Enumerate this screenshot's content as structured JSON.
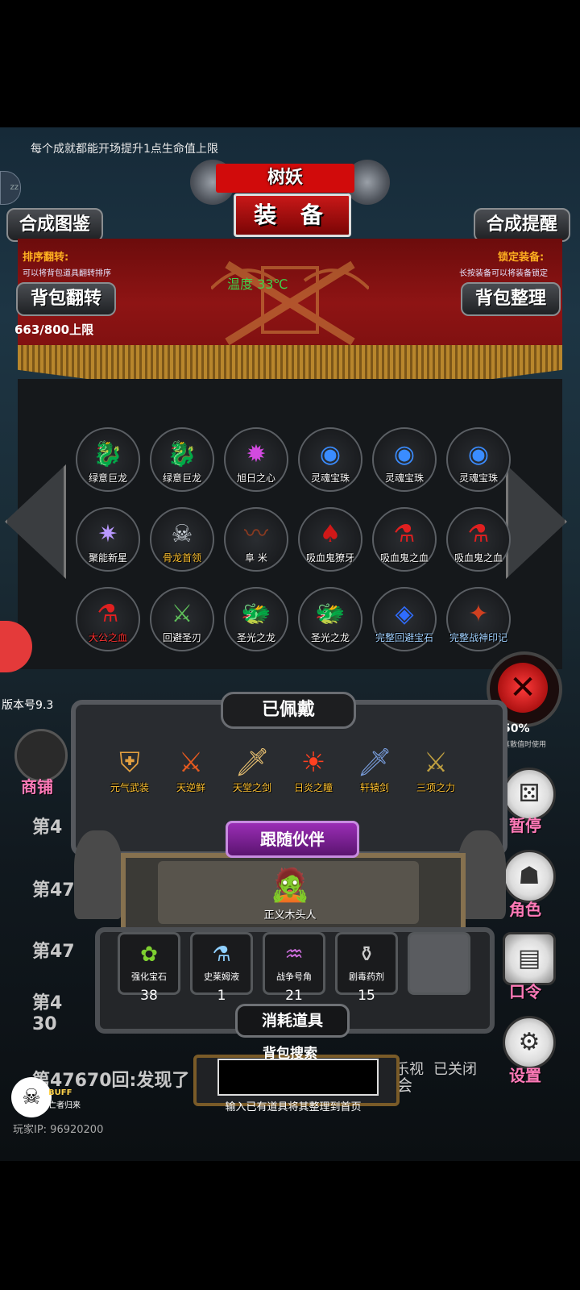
{
  "top_tip": "每个成就都能开场提升1点生命值上限",
  "banner": {
    "name": "树妖",
    "title": "装 备"
  },
  "buttons": {
    "compose_guide": "合成图鉴",
    "compose_remind": "合成提醒",
    "bag_flip": "背包翻转",
    "bag_sort": "背包整理"
  },
  "sort_flip": {
    "head": "排序翻转:",
    "desc": "可以将背包道具翻转排序"
  },
  "lock_equip": {
    "head": "锁定装备:",
    "desc": "长按装备可以将装备锁定"
  },
  "temperature": "温度 33℃",
  "capacity": "663/800上限",
  "inventory": [
    {
      "label": "绿意巨龙",
      "icon": "green-dragon",
      "color": "#ffffff"
    },
    {
      "label": "绿意巨龙",
      "icon": "green-dragon",
      "color": "#ffffff"
    },
    {
      "label": "旭日之心",
      "icon": "rising-sun-heart",
      "color": "#ffffff"
    },
    {
      "label": "灵魂宝珠",
      "icon": "soul-orb",
      "color": "#ffffff"
    },
    {
      "label": "灵魂宝珠",
      "icon": "soul-orb",
      "color": "#ffffff"
    },
    {
      "label": "灵魂宝珠",
      "icon": "soul-orb",
      "color": "#ffffff"
    },
    {
      "label": "聚能新星",
      "icon": "nova",
      "color": "#ffffff"
    },
    {
      "label": "骨龙首领",
      "icon": "bone-dragon",
      "color": "#ffc230"
    },
    {
      "label": "阜 米",
      "icon": "whip",
      "color": "#ffffff"
    },
    {
      "label": "吸血鬼獠牙",
      "icon": "vampire-fang",
      "color": "#ffffff"
    },
    {
      "label": "吸血鬼之血",
      "icon": "blood-potion",
      "color": "#ffffff"
    },
    {
      "label": "吸血鬼之血",
      "icon": "blood-potion",
      "color": "#ffffff"
    },
    {
      "label": "大公之血",
      "icon": "blood-potion",
      "color": "#ff3030"
    },
    {
      "label": "回避圣刃",
      "icon": "holy-blade",
      "color": "#ffffff"
    },
    {
      "label": "圣光之龙",
      "icon": "gold-dragon",
      "color": "#ffffff"
    },
    {
      "label": "圣光之龙",
      "icon": "gold-dragon",
      "color": "#ffffff"
    },
    {
      "label": "完整回避宝石",
      "icon": "blue-gem",
      "color": "#9fd0ff"
    },
    {
      "label": "完整战神印记",
      "icon": "war-seal",
      "color": "#9fd0ff"
    }
  ],
  "equipped_title": "已佩戴",
  "equipped": [
    {
      "label": "元气武装",
      "icon": "armor"
    },
    {
      "label": "天逆鲜",
      "icon": "orb-sword"
    },
    {
      "label": "天堂之剑",
      "icon": "heaven-sword"
    },
    {
      "label": "日炎之瞳",
      "icon": "sun-eye"
    },
    {
      "label": "轩辕剑",
      "icon": "xuanyuan-sword"
    },
    {
      "label": "三项之力",
      "icon": "triforce-sword"
    }
  ],
  "companion_tag": "跟随伙伴",
  "companion": {
    "label": "正义木头人",
    "icon": "wooden-man"
  },
  "consumables_title": "消耗道具",
  "consumables": [
    {
      "label": "强化宝石",
      "count": "38",
      "icon": "enhance-gem"
    },
    {
      "label": "史莱姆液",
      "count": "1",
      "icon": "slime-flask"
    },
    {
      "label": "战争号角",
      "count": "21",
      "icon": "war-horn"
    },
    {
      "label": "剧毒药剂",
      "count": "15",
      "icon": "poison-flask"
    },
    {
      "label": "",
      "count": "",
      "icon": "empty"
    }
  ],
  "search": {
    "title": "背包搜索",
    "hint": "输入已有道具将其整理到首页",
    "value": ""
  },
  "side": {
    "shop": "商铺",
    "pause": "暂停",
    "role": "角色",
    "code": "口令",
    "settings": "设置",
    "stat_value": "50%",
    "stat_note": "真散值时使用"
  },
  "version": "版本号9.3",
  "log": {
    "l1": "第4",
    "l2": "第47",
    "l3": "第47",
    "l4": "第4",
    "l5": "30",
    "l6": "第47670回:发现了"
  },
  "bg_labels": {
    "watch": "乐视",
    "closed": "已关闭",
    "meet": "会"
  },
  "buff": {
    "label": "BUFF",
    "sub": "亡者归来"
  },
  "player_ip": "玩家IP: 96920200"
}
